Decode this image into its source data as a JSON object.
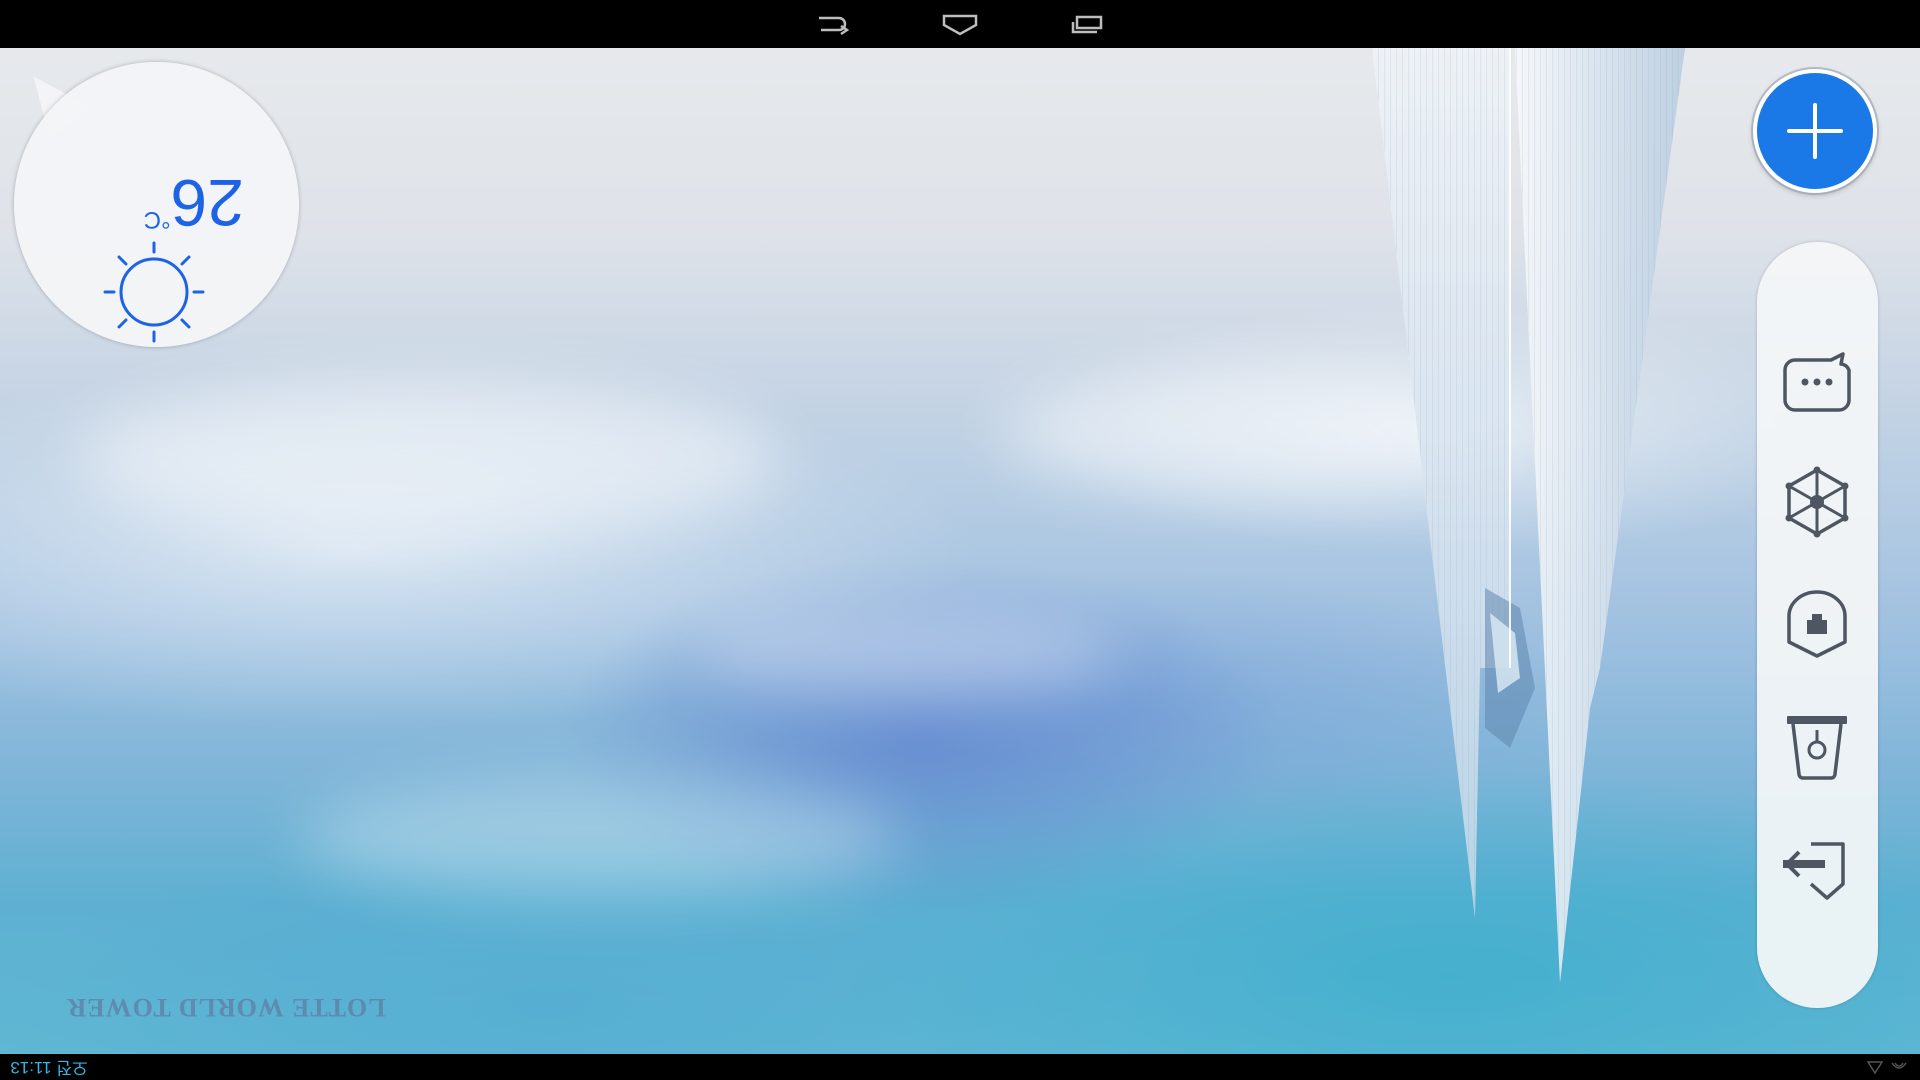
{
  "navbar": {
    "buttons": [
      {
        "name": "back",
        "icon": "back-icon"
      },
      {
        "name": "home",
        "icon": "home-icon"
      },
      {
        "name": "recents",
        "icon": "recent-apps-icon"
      }
    ]
  },
  "weather": {
    "temperature": "26",
    "unit": "°C",
    "icon": "sun-icon",
    "color": "#1e63e6"
  },
  "wallpaper": {
    "brand": "LOTTE WORLD TOWER"
  },
  "add_button": {
    "icon": "plus-icon",
    "color": "#1a79e6"
  },
  "dock": {
    "items": [
      {
        "name": "chat",
        "icon": "chat-bubble-icon"
      },
      {
        "name": "network",
        "icon": "network-hexagon-icon"
      },
      {
        "name": "shield",
        "icon": "shield-icon"
      },
      {
        "name": "trash",
        "icon": "trash-icon"
      },
      {
        "name": "exit",
        "icon": "exit-icon"
      }
    ]
  },
  "statusbar": {
    "clock": "오전 11:13",
    "accent": "#33b5e5"
  }
}
